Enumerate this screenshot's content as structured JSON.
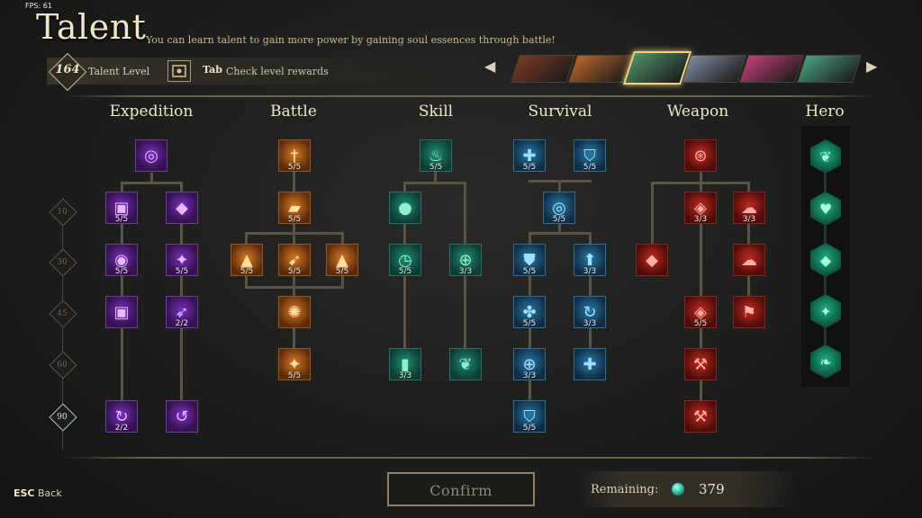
{
  "fps": "FPS: 61",
  "title": "Talent",
  "subtitle": "You can learn talent to gain more power by gaining soul essences through battle!",
  "talent_level": {
    "value": "164",
    "label": "Talent Level"
  },
  "tab_hint": {
    "key": "Tab",
    "text": "Check level rewards"
  },
  "nav": {
    "prev": "◀",
    "next": "▶"
  },
  "heroes": [
    {
      "name": "hero-1",
      "color": "#7a3a24"
    },
    {
      "name": "hero-2",
      "color": "#b8652a"
    },
    {
      "name": "hero-3",
      "color": "#4f8f6a",
      "selected": true
    },
    {
      "name": "hero-4",
      "color": "#7d8aa0"
    },
    {
      "name": "hero-5",
      "color": "#c0407a"
    },
    {
      "name": "hero-6",
      "color": "#4aa080"
    }
  ],
  "categories": [
    "Expedition",
    "Battle",
    "Skill",
    "Survival",
    "Weapon",
    "Hero"
  ],
  "levels": [
    "10",
    "30",
    "45",
    "60",
    "90"
  ],
  "nodes": {
    "exp_top": {
      "count": "",
      "icon": "swirl-icon"
    },
    "exp_a1": {
      "count": "5/5",
      "icon": "coin-icon"
    },
    "exp_b1": {
      "count": "",
      "icon": "pouch-icon"
    },
    "exp_a2": {
      "count": "5/5",
      "icon": "coins-icon"
    },
    "exp_b2": {
      "count": "5/5",
      "icon": "discount-icon"
    },
    "exp_a3": {
      "count": "",
      "icon": "coin-glow-icon"
    },
    "exp_b3": {
      "count": "2/2",
      "icon": "feather-icon"
    },
    "exp_a4": {
      "count": "2/2",
      "icon": "recycle-icon"
    },
    "exp_b4": {
      "count": "",
      "icon": "spiral-icon"
    },
    "bat_1": {
      "count": "5/5",
      "icon": "sword-icon"
    },
    "bat_2": {
      "count": "5/5",
      "icon": "fist-icon"
    },
    "bat_3l": {
      "count": "5/5",
      "icon": "bullet-icon"
    },
    "bat_3c": {
      "count": "5/5",
      "icon": "blade-icon"
    },
    "bat_3r": {
      "count": "5/5",
      "icon": "bullet-icon"
    },
    "bat_4": {
      "count": "",
      "icon": "burst-icon"
    },
    "bat_5": {
      "count": "5/5",
      "icon": "star-icon"
    },
    "ski_1": {
      "count": "5/5",
      "icon": "flame-icon"
    },
    "ski_2": {
      "count": "",
      "icon": "potion-icon"
    },
    "ski_3l": {
      "count": "5/5",
      "icon": "clock-icon"
    },
    "ski_3r": {
      "count": "3/3",
      "icon": "heal-icon"
    },
    "ski_4l": {
      "count": "3/3",
      "icon": "flask-icon"
    },
    "ski_4r": {
      "count": "",
      "icon": "leaf-icon"
    },
    "sur_1a": {
      "count": "5/5",
      "icon": "plus-icon"
    },
    "sur_1b": {
      "count": "5/5",
      "icon": "armor-icon"
    },
    "sur_2": {
      "count": "5/5",
      "icon": "cycle-icon"
    },
    "sur_3a": {
      "count": "5/5",
      "icon": "shield-icon"
    },
    "sur_3b": {
      "count": "3/3",
      "icon": "up-arrow-icon"
    },
    "sur_4a": {
      "count": "5/5",
      "icon": "fan-icon"
    },
    "sur_4b": {
      "count": "3/3",
      "icon": "swirl-icon"
    },
    "sur_5a": {
      "count": "3/3",
      "icon": "plus-ring-icon"
    },
    "sur_5b": {
      "count": "",
      "icon": "plus-icon"
    },
    "sur_6": {
      "count": "5/5",
      "icon": "cape-icon"
    },
    "wep_1": {
      "count": "",
      "icon": "target-icon"
    },
    "wep_2a": {
      "count": "3/3",
      "icon": "gem-icon"
    },
    "wep_2b": {
      "count": "3/3",
      "icon": "cloud-icon"
    },
    "wep_3a": {
      "count": "",
      "icon": "diamond-icon"
    },
    "wep_3b": {
      "count": "",
      "icon": "cloud-icon"
    },
    "wep_4a": {
      "count": "5/5",
      "icon": "gem-icon"
    },
    "wep_4b": {
      "count": "",
      "icon": "banner-icon"
    },
    "wep_5": {
      "count": "",
      "icon": "anvil-icon"
    },
    "wep_6": {
      "count": "",
      "icon": "hammer-icon"
    }
  },
  "hero_talents": [
    "wings-icon",
    "heart-wings-icon",
    "gem-icon",
    "double-wings-icon",
    "leaf-icon"
  ],
  "esc": {
    "key": "ESC",
    "label": "Back"
  },
  "confirm_label": "Confirm",
  "remaining": {
    "label": "Remaining:",
    "value": "379"
  }
}
